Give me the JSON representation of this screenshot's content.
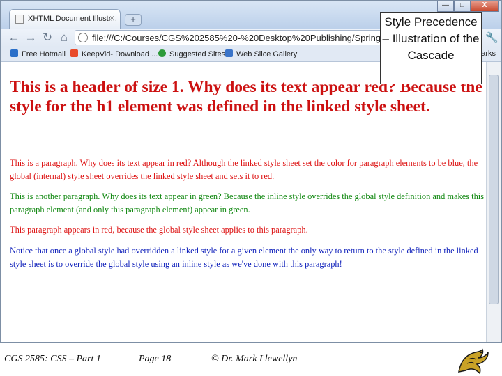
{
  "browser": {
    "tab_title": "XHTML Document Illustr...",
    "tab_close": "×",
    "new_tab": "+",
    "window_buttons": [
      "—",
      "□",
      "X"
    ],
    "url": "file:///C:/Courses/CGS%202585%20-%20Desktop%20Publishing/Spring%20",
    "bookmarks": [
      {
        "label": "Free Hotmail",
        "icon": "hotmail-icon",
        "color": "#2a6fc9"
      },
      {
        "label": "KeepVid- Download ...",
        "icon": "keepvid-icon",
        "color": "#e84a2a"
      },
      {
        "label": "Suggested Sites",
        "icon": "suggested-sites-icon",
        "color": "#2c9a3a"
      },
      {
        "label": "Web Slice Gallery",
        "icon": "web-slice-icon",
        "color": "#3a74c9"
      }
    ],
    "bookmarks_more": "arks"
  },
  "page": {
    "h1": "This is a header of size 1. Why does its text appear red? Because the style for the h1 element was defined in the linked style sheet.",
    "paragraphs": [
      "This is a paragraph. Why does its text appear in red? Although the linked style sheet set the color for paragraph elements to be blue, the global (internal) style sheet overrides the linked style sheet and sets it to red.",
      "This is another paragraph. Why does its text appear in green? Because the inline style overrides the global style definition and makes this paragraph element (and only this paragraph element) appear in green.",
      "This paragraph appears in red, because the global style sheet applies to this paragraph.",
      "Notice that once a global style had overridden a linked style for a given element the only way to return to the style defined in the linked style sheet is to override the global style using an inline style as we've done with this paragraph!"
    ],
    "colors": {
      "h1": "#cc1111",
      "red": "#dd1111",
      "green": "#118811",
      "blue": "#1122bb"
    }
  },
  "slide": {
    "title": "Style Precedence – Illustration of the Cascade"
  },
  "footer": {
    "course": "CGS 2585: CSS – Part 1",
    "page": "Page 18",
    "author": "© Dr. Mark Llewellyn",
    "logo": "ucf-pegasus-logo"
  }
}
